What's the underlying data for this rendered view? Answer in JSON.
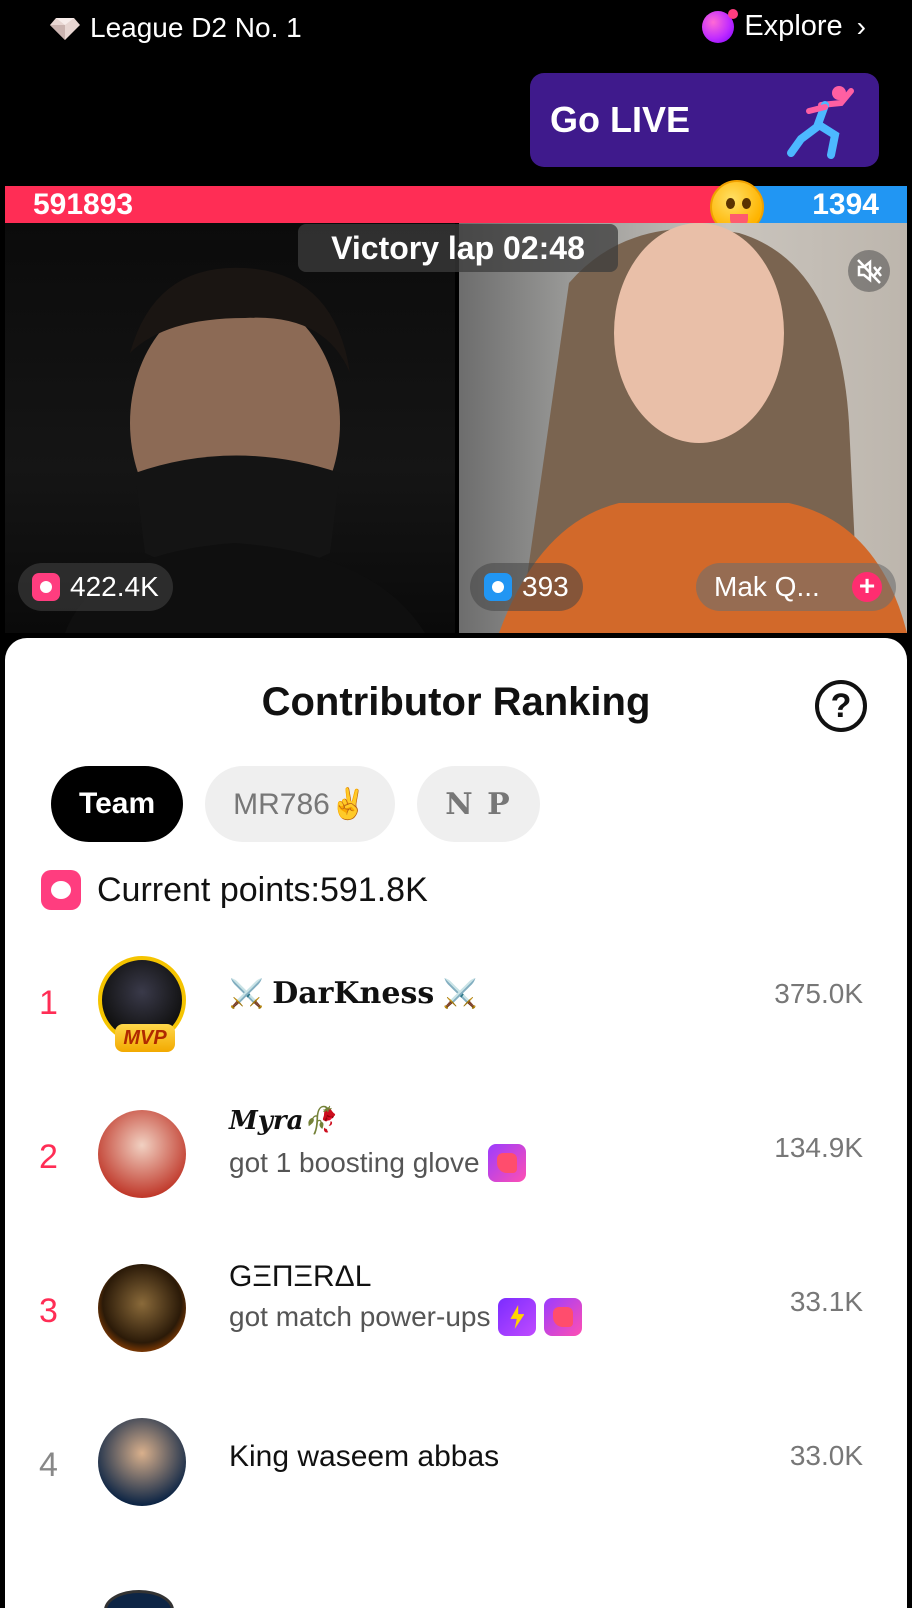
{
  "top": {
    "league_label": "League D2 No. 1",
    "explore_label": "Explore",
    "go_live_label": "Go LIVE"
  },
  "battle": {
    "left_score": "591893",
    "right_score": "1394",
    "timer_label": "Victory lap 02:48",
    "left_count": "422.4K",
    "right_count": "393",
    "right_user": "Mak Q..."
  },
  "sheet": {
    "title": "Contributor Ranking",
    "help_label": "?",
    "tabs": [
      {
        "label": "Team"
      },
      {
        "label": "MR786✌️"
      },
      {
        "label": "N P"
      }
    ],
    "points_label": "Current points:591.8K",
    "rows": [
      {
        "rank": "1",
        "name": "DarKness",
        "sub": "",
        "value": "375.0K",
        "badge": "MVP"
      },
      {
        "rank": "2",
        "name": "Myra🥀",
        "sub": "got 1 boosting glove",
        "value": "134.9K"
      },
      {
        "rank": "3",
        "name": "GΞΠΞRΔL",
        "sub": "got match power-ups",
        "value": "33.1K"
      },
      {
        "rank": "4",
        "name": "King waseem abbas",
        "sub": "",
        "value": "33.0K"
      }
    ]
  },
  "colors": {
    "red": "#ff2d55",
    "blue": "#2196f3",
    "purple": "#3f1a8c"
  }
}
